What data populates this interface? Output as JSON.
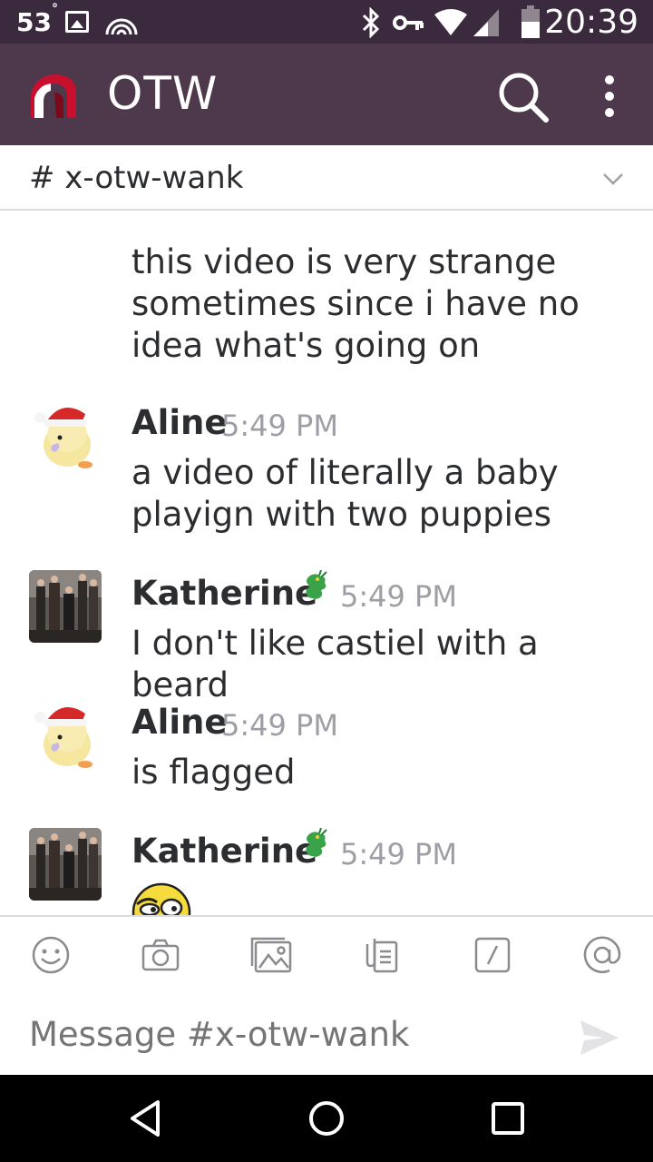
{
  "status_bar": {
    "temperature": "53",
    "degree": "°",
    "time": "20:39"
  },
  "app": {
    "title": "OTW",
    "logo_icon": "otw-logo-icon",
    "brand_color": "#4d394b",
    "status_color": "#3b2a3d"
  },
  "channel": {
    "name": "# x-otw-wank"
  },
  "messages": [
    {
      "continuation": true,
      "text": "this video is very strange sometimes since i have no idea what's going on"
    },
    {
      "author": "Aline",
      "time": "5:49 PM",
      "text": "a video of literally a baby playign with two puppies",
      "avatar_icon": "chick-santa-hat-avatar"
    },
    {
      "author": "Katherine",
      "time": "5:49 PM",
      "text": "I don't like castiel with a beard",
      "avatar_icon": "group-photo-avatar",
      "status_icon": "dragon-emoji-icon"
    },
    {
      "author": "Aline",
      "time": "5:49 PM",
      "text": "is flagged",
      "avatar_icon": "chick-santa-hat-avatar"
    },
    {
      "author": "Katherine",
      "time": "5:49 PM",
      "text": "",
      "avatar_icon": "group-photo-avatar",
      "status_icon": "dragon-emoji-icon",
      "emoji": "suspicious-face-emoji"
    }
  ],
  "composer": {
    "placeholder": "Message #x-otw-wank",
    "tools": [
      "emoji-icon",
      "camera-icon",
      "photo-icon",
      "file-icon",
      "slash-command-icon",
      "mention-icon"
    ]
  },
  "nav": {
    "buttons": [
      "back-icon",
      "home-icon",
      "recents-icon"
    ]
  }
}
